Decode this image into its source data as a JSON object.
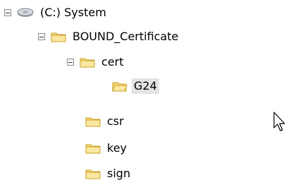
{
  "tree": {
    "root": {
      "label": "(C:) System",
      "icon": "drive-icon",
      "expanded": true
    },
    "items": [
      {
        "label": "BOUND_Certificate",
        "icon": "folder-icon",
        "expanded": true
      },
      {
        "label": "cert",
        "icon": "folder-icon",
        "expanded": true
      },
      {
        "label": "G24",
        "icon": "folder-open-icon",
        "selected": true
      },
      {
        "label": "csr",
        "icon": "folder-icon"
      },
      {
        "label": "key",
        "icon": "folder-icon"
      },
      {
        "label": "sign",
        "icon": "folder-icon"
      }
    ]
  },
  "cursor": {
    "icon": "mouse-pointer-icon"
  }
}
